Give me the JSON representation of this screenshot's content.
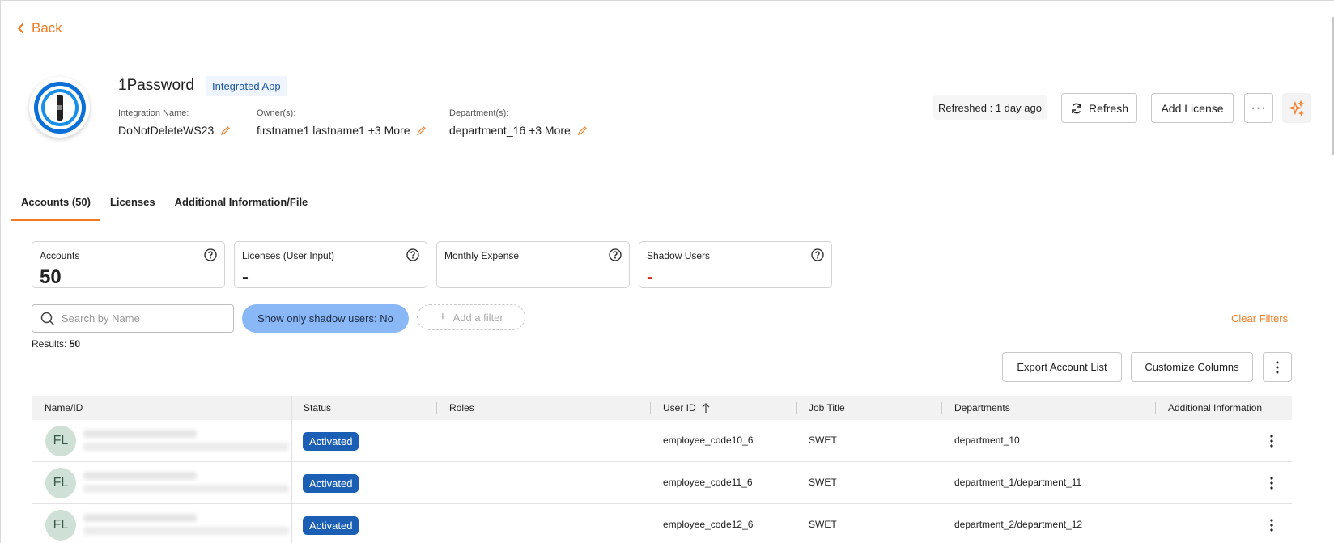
{
  "nav": {
    "back_label": "Back"
  },
  "app": {
    "name": "1Password",
    "badge": "Integrated App",
    "integration_name_label": "Integration Name:",
    "integration_name": "DoNotDeleteWS23",
    "owners_label": "Owner(s):",
    "owners": "firstname1 lastname1 +3 More",
    "departments_label": "Department(s):",
    "departments": "department_16 +3 More"
  },
  "toolbar": {
    "refreshed": "Refreshed : 1 day ago",
    "refresh_label": "Refresh",
    "add_license_label": "Add License",
    "more_label": "···"
  },
  "tabs": [
    {
      "label": "Accounts (50)",
      "active": true
    },
    {
      "label": "Licenses",
      "active": false
    },
    {
      "label": "Additional Information/File",
      "active": false
    }
  ],
  "stats": [
    {
      "title": "Accounts",
      "value": "50"
    },
    {
      "title": "Licenses (User Input)",
      "value": "-"
    },
    {
      "title": "Monthly Expense",
      "value": ""
    },
    {
      "title": "Shadow Users",
      "value": "-"
    }
  ],
  "filters": {
    "search_placeholder": "Search by Name",
    "shadow_chip": "Show only shadow users: No",
    "add_filter": "Add a filter",
    "clear": "Clear Filters",
    "results_label": "Results:",
    "results_count": "50"
  },
  "actions": {
    "export_label": "Export Account List",
    "customize_label": "Customize Columns"
  },
  "table": {
    "columns": [
      "Name/ID",
      "Status",
      "Roles",
      "User ID",
      "Job Title",
      "Departments",
      "Additional Information"
    ],
    "rows": [
      {
        "initials": "FL",
        "status": "Activated",
        "roles": "",
        "user_id": "employee_code10_6",
        "job_title": "SWET",
        "departments": "department_10"
      },
      {
        "initials": "FL",
        "status": "Activated",
        "roles": "",
        "user_id": "employee_code11_6",
        "job_title": "SWET",
        "departments": "department_1/department_11"
      },
      {
        "initials": "FL",
        "status": "Activated",
        "roles": "",
        "user_id": "employee_code12_6",
        "job_title": "SWET",
        "departments": "department_2/department_12"
      }
    ]
  },
  "colors": {
    "accent": "#f07a22",
    "status_activated": "#1a5fb4",
    "chip_blue": "#8ab7f6",
    "shadow_red": "#e02424"
  }
}
